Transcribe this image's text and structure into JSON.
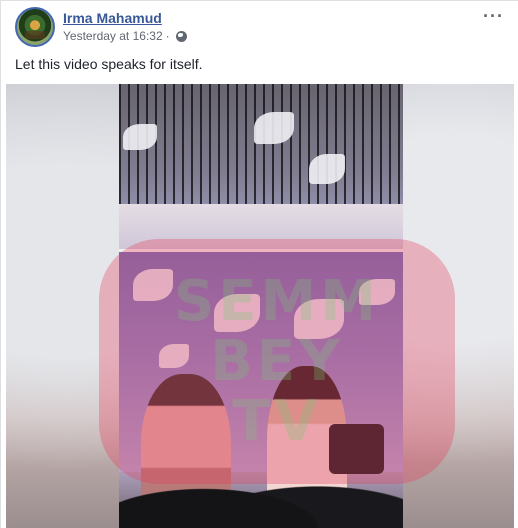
{
  "post": {
    "author": "Irma Mahamud",
    "timestamp": "Yesterday at 16:32",
    "separator": "·",
    "privacy_icon": "globe-icon",
    "more_icon": "ellipsis-icon",
    "more_label": "···",
    "message": "Let this video speaks for itself.",
    "watermark": "SEMM\nBEY\nTV"
  },
  "colors": {
    "author_link": "#385898",
    "meta_text": "#616770",
    "body_text": "#1d2129",
    "watermark": "#e63c5a"
  }
}
